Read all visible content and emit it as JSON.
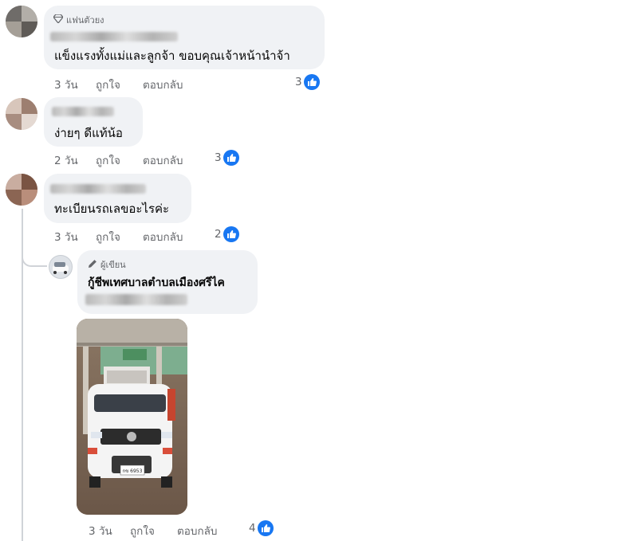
{
  "comments": [
    {
      "badge": "แฟนตัวยง",
      "text": "แข็งแรงทั้งแม่และลูกจ้า ขอบคุณเจ้าหน้านำจ้า",
      "time": "3 วัน",
      "like_label": "ถูกใจ",
      "reply_label": "ตอบกลับ",
      "reactions": "3"
    },
    {
      "text": "ง่ายๆ ดีแท้น้อ",
      "time": "2 วัน",
      "like_label": "ถูกใจ",
      "reply_label": "ตอบกลับ",
      "reactions": "3"
    },
    {
      "text": "ทะเบียนรถเลขอะไรค่ะ",
      "time": "3 วัน",
      "like_label": "ถูกใจ",
      "reply_label": "ตอบกลับ",
      "reactions": "2"
    }
  ],
  "reply": {
    "badge": "ผู้เขียน",
    "author": "กู้ชีพเทศบาลตำบลเมืองศรีไค",
    "time": "3 วัน",
    "like_label": "ถูกใจ",
    "reply_label": "ตอบกลับ",
    "reactions": "4",
    "plate_text": "กข 6953"
  },
  "colors": {
    "bubble": "#f0f2f5",
    "like_blue": "#1877f2",
    "meta_gray": "#65676b"
  }
}
